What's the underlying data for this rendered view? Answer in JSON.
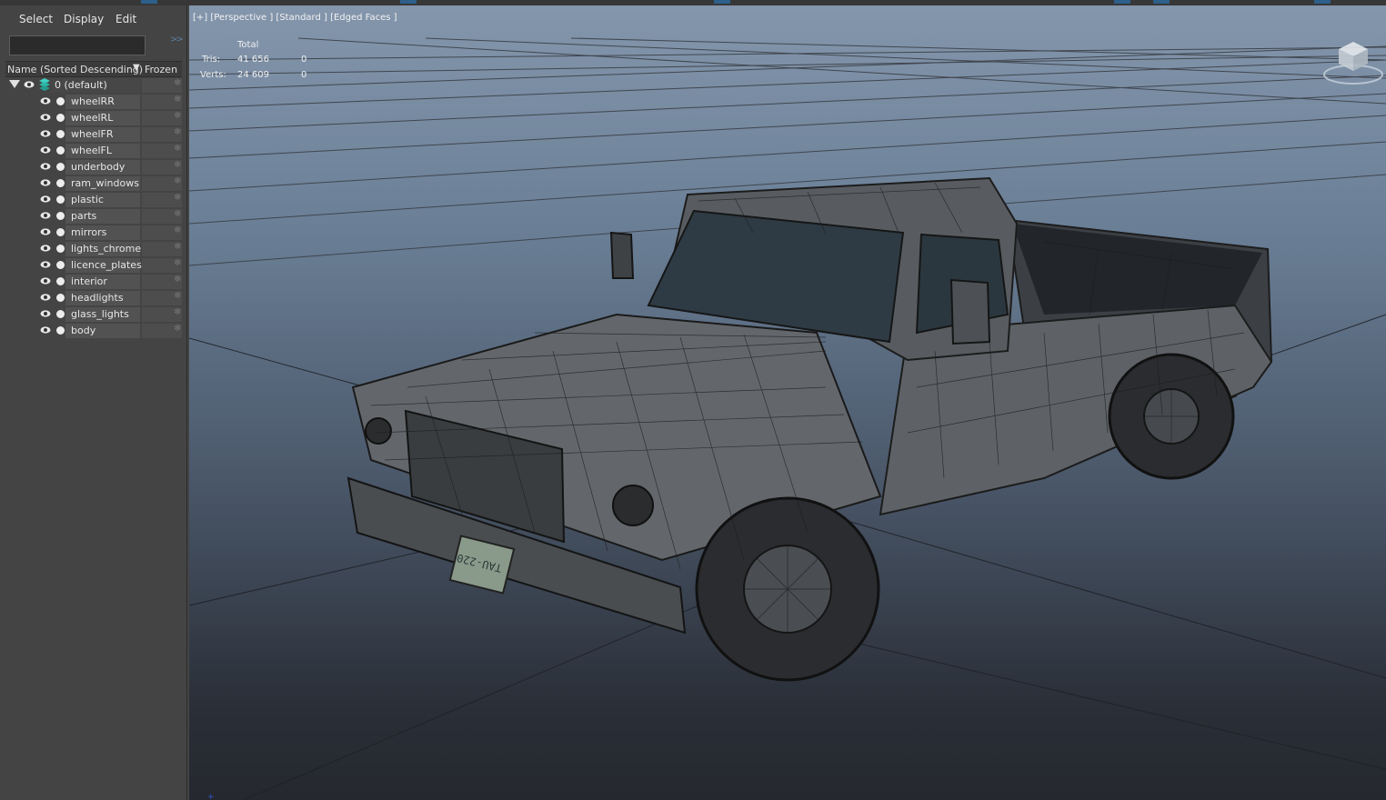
{
  "menu": {
    "select": "Select",
    "display": "Display",
    "edit": "Edit"
  },
  "search": {
    "placeholder": ""
  },
  "expand_icon": ">>",
  "header": {
    "name_column": "Name (Sorted Descending)",
    "sort_icon": "▼",
    "frozen_column": "Frozen"
  },
  "default_layer": {
    "label": "0 (default)"
  },
  "layers": [
    {
      "label": "wheelRR"
    },
    {
      "label": "wheelRL"
    },
    {
      "label": "wheelFR"
    },
    {
      "label": "wheelFL"
    },
    {
      "label": "underbody"
    },
    {
      "label": "ram_windows"
    },
    {
      "label": "plastic"
    },
    {
      "label": "parts"
    },
    {
      "label": "mirrors"
    },
    {
      "label": "lights_chrome"
    },
    {
      "label": "licence_plates"
    },
    {
      "label": "interior"
    },
    {
      "label": "headlights"
    },
    {
      "label": "glass_lights"
    },
    {
      "label": "body"
    }
  ],
  "viewport": {
    "title": "[+] [Perspective ] [Standard ] [Edged Faces ]",
    "stats": {
      "total_header": "Total",
      "tris_label": "Tris:",
      "tris_total": "41 656",
      "tris_selected": "0",
      "verts_label": "Verts:",
      "verts_total": "24 609",
      "verts_selected": "0"
    },
    "plate_text": "TAU-220",
    "background_top": "#8496ac",
    "background_bottom": "#25282e"
  },
  "icons": {
    "expand": "chevron-double-right-icon",
    "visibility": "eye-icon",
    "freeze": "snowflake-icon",
    "layer": "layer-stack-icon",
    "viewcube": "viewcube-icon"
  }
}
